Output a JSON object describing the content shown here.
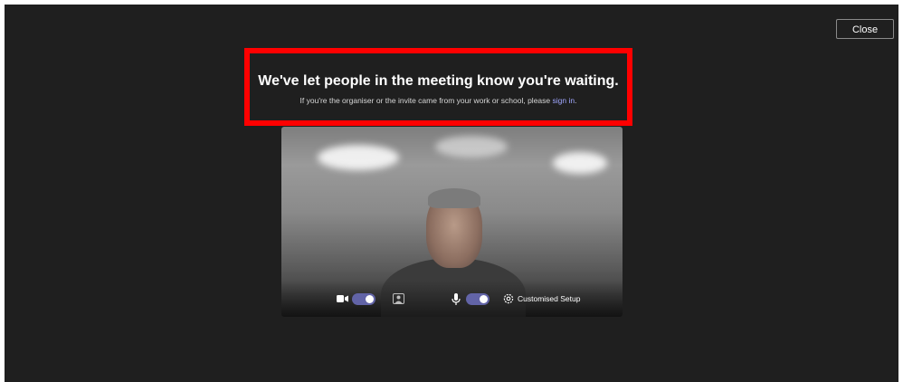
{
  "header": {
    "close_label": "Close"
  },
  "message": {
    "headline": "We've let people in the meeting know you're waiting.",
    "subline_prefix": "If you're the organiser or the invite came from your work or school, please ",
    "sign_in_link": "sign in",
    "subline_suffix": "."
  },
  "controls": {
    "camera": {
      "icon": "camera-icon",
      "on": true
    },
    "background": {
      "icon": "background-effects-icon"
    },
    "microphone": {
      "icon": "microphone-icon",
      "on": true
    },
    "setup": {
      "icon": "settings-icon",
      "label": "Customised Setup"
    }
  },
  "colors": {
    "accent": "#6264a7",
    "highlight": "#ff0000",
    "background": "#1f1f1f",
    "link": "#a0a7ff"
  }
}
